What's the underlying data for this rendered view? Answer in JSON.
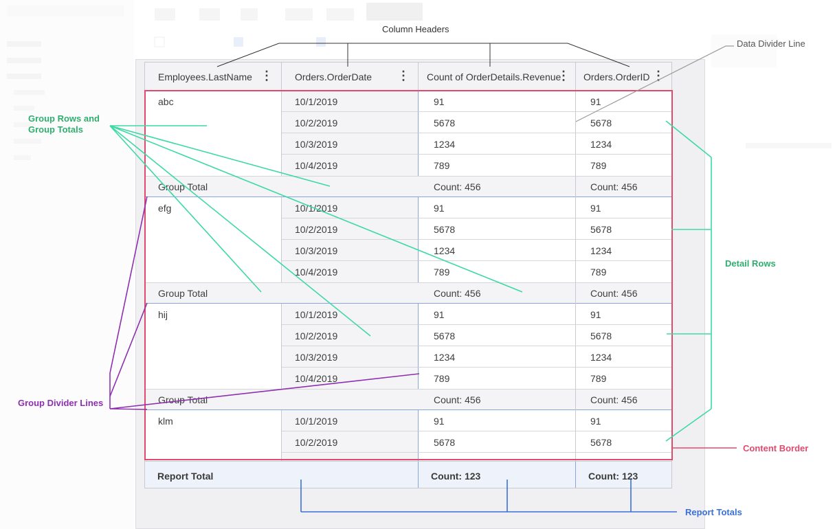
{
  "columns": [
    {
      "label": "Employees.LastName"
    },
    {
      "label": "Orders.OrderDate"
    },
    {
      "label": "Count of OrderDetails.Revenue"
    },
    {
      "label": "Orders.OrderID"
    }
  ],
  "kebab_icon": "more-vertical-icon",
  "groups": [
    {
      "name": "abc",
      "rows": [
        {
          "date": "10/1/2019",
          "revenue": "91",
          "order": "91"
        },
        {
          "date": "10/2/2019",
          "revenue": "5678",
          "order": "5678"
        },
        {
          "date": "10/3/2019",
          "revenue": "1234",
          "order": "1234"
        },
        {
          "date": "10/4/2019",
          "revenue": "789",
          "order": "789"
        }
      ],
      "total": {
        "label": "Group Total",
        "revenue": "Count: 456",
        "order": "Count: 456"
      }
    },
    {
      "name": "efg",
      "rows": [
        {
          "date": "10/1/2019",
          "revenue": "91",
          "order": "91"
        },
        {
          "date": "10/2/2019",
          "revenue": "5678",
          "order": "5678"
        },
        {
          "date": "10/3/2019",
          "revenue": "1234",
          "order": "1234"
        },
        {
          "date": "10/4/2019",
          "revenue": "789",
          "order": "789"
        }
      ],
      "total": {
        "label": "Group Total",
        "revenue": "Count: 456",
        "order": "Count: 456"
      }
    },
    {
      "name": "hij",
      "rows": [
        {
          "date": "10/1/2019",
          "revenue": "91",
          "order": "91"
        },
        {
          "date": "10/2/2019",
          "revenue": "5678",
          "order": "5678"
        },
        {
          "date": "10/3/2019",
          "revenue": "1234",
          "order": "1234"
        },
        {
          "date": "10/4/2019",
          "revenue": "789",
          "order": "789"
        }
      ],
      "total": {
        "label": "Group Total",
        "revenue": "Count: 456",
        "order": "Count: 456"
      }
    },
    {
      "name": "klm",
      "rows": [
        {
          "date": "10/1/2019",
          "revenue": "91",
          "order": "91"
        },
        {
          "date": "10/2/2019",
          "revenue": "5678",
          "order": "5678"
        }
      ],
      "total": null
    }
  ],
  "report_total": {
    "label": "Report Total",
    "revenue": "Count: 123",
    "order": "Count: 123"
  },
  "annotations": {
    "column_headers": "Column Headers",
    "data_divider_line": "Data Divider Line",
    "group_rows_totals_l1": "Group Rows and",
    "group_rows_totals_l2": "Group Totals",
    "detail_rows": "Detail Rows",
    "group_divider_lines": "Group Divider Lines",
    "content_border": "Content Border",
    "report_totals": "Report Totals"
  },
  "colors": {
    "black": "#333333",
    "gray": "#9a9a9a",
    "green": "#3dd9a4",
    "green_text": "#2fae6e",
    "purple": "#8e2fb0",
    "pink": "#e04a6e",
    "blue": "#3a6fd8"
  }
}
